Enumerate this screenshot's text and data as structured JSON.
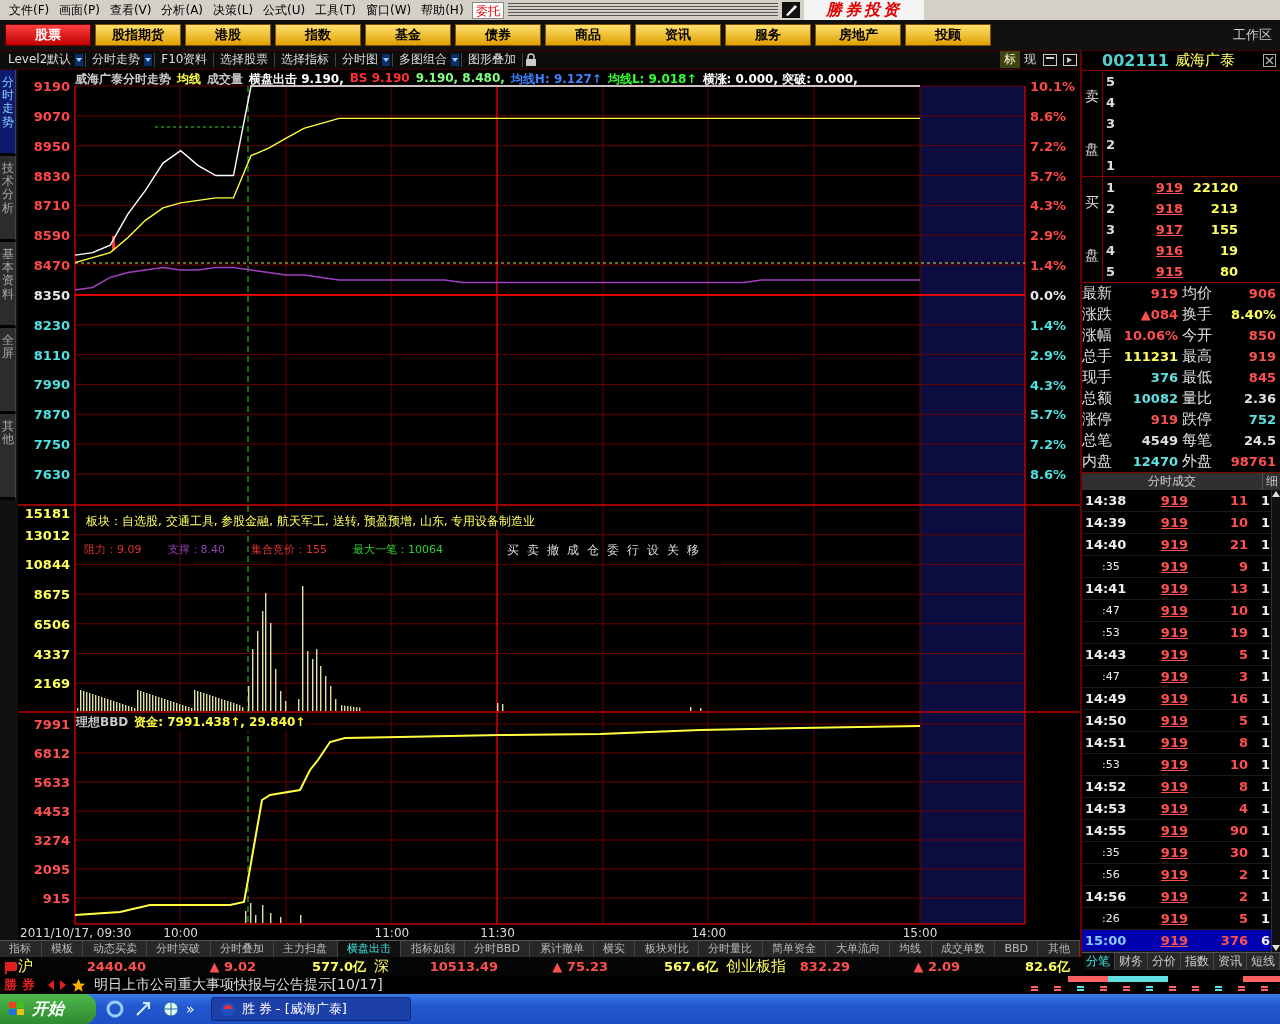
{
  "menu": [
    "文件(F)",
    "画面(P)",
    "查看(V)",
    "分析(A)",
    "决策(L)",
    "公式(U)",
    "工具(T)",
    "窗口(W)",
    "帮助(H)"
  ],
  "order_button": "委托",
  "logo_text": "勝券投资",
  "categories": [
    {
      "label": "股票",
      "selected": true
    },
    {
      "label": "股指期货",
      "selected": false
    },
    {
      "label": "港股",
      "selected": false
    },
    {
      "label": "指数",
      "selected": false
    },
    {
      "label": "基金",
      "selected": false
    },
    {
      "label": "债券",
      "selected": false
    },
    {
      "label": "商品",
      "selected": false
    },
    {
      "label": "资讯",
      "selected": false
    },
    {
      "label": "服务",
      "selected": false
    },
    {
      "label": "房地产",
      "selected": false
    },
    {
      "label": "投顾",
      "selected": false
    }
  ],
  "workspace_label": "工作区",
  "toolbar": [
    {
      "label": "Level2默认",
      "dropdown": true
    },
    {
      "label": "分时走势",
      "dropdown": true
    },
    {
      "label": "F10资料",
      "dropdown": false
    },
    {
      "label": "选择股票",
      "dropdown": false
    },
    {
      "label": "选择指标",
      "dropdown": false
    },
    {
      "label": "分时图",
      "dropdown": true
    },
    {
      "label": "多图组合",
      "dropdown": true
    },
    {
      "label": "图形叠加",
      "dropdown": false
    }
  ],
  "toolbar_right": [
    {
      "label": "标",
      "selected": true
    },
    {
      "label": "现",
      "selected": false
    }
  ],
  "side_tabs": [
    {
      "label": "分时走势",
      "selected": true
    },
    {
      "label": "技术分析",
      "selected": false
    },
    {
      "label": "基本资料",
      "selected": false
    },
    {
      "label": "全屏",
      "selected": false
    },
    {
      "label": "其他",
      "selected": false
    }
  ],
  "chart": {
    "legend": [
      {
        "text": "威海广泰分时走势",
        "color": "#c8c8c8"
      },
      {
        "text": "成交量",
        "color": "#c8c8c8"
      },
      {
        "text": "横盘出击 9.190,",
        "color": "#ffffff"
      },
      {
        "text": "BS 9.190",
        "color": "#ff3030"
      },
      {
        "text": "9.190, 8.480,",
        "color": "#80ff80"
      },
      {
        "text": "均线H: 9.127↑",
        "color": "#4080ff"
      },
      {
        "text": "均线L: 9.018↑",
        "color": "#30ff30"
      },
      {
        "text": "横涨: 0.000, 突破: 0.000,",
        "color": "#ffffff"
      }
    ],
    "chart_data": {
      "type": "line",
      "categories": [
        null,
        null,
        null,
        null,
        null,
        null,
        null,
        null,
        null,
        null,
        null,
        null,
        null,
        null,
        null,
        null,
        null,
        null,
        null,
        null,
        null,
        null,
        null,
        null,
        null,
        null,
        null,
        null,
        null,
        null,
        null,
        null,
        null,
        null,
        null,
        null,
        null,
        null,
        null,
        null,
        null,
        null,
        null,
        null,
        null,
        null,
        null,
        null,
        null
      ],
      "ylim": [
        7630,
        9190
      ],
      "yticks": [
        {
          "value": 9190,
          "label": "9190"
        },
        {
          "value": 9070,
          "label": "9070"
        },
        {
          "value": 8950,
          "label": "8950"
        },
        {
          "value": 8830,
          "label": "8830"
        },
        {
          "value": 8710,
          "label": "8710"
        },
        {
          "value": 8590,
          "label": "8590"
        },
        {
          "value": 8470,
          "label": "8470"
        },
        {
          "value": 8350,
          "label": "8350"
        },
        {
          "value": 8230,
          "label": "8230"
        },
        {
          "value": 8110,
          "label": "8110"
        },
        {
          "value": 7990,
          "label": "7990"
        },
        {
          "value": 7870,
          "label": "7870"
        },
        {
          "value": 7750,
          "label": "7750"
        },
        {
          "value": 7630,
          "label": "7630"
        }
      ],
      "series": [
        {
          "color": "#ffffff",
          "values": [
            8510,
            8520,
            8550,
            8675,
            8770,
            8880,
            8930,
            8870,
            8830,
            8830,
            9190,
            9190,
            9190,
            9190,
            9190,
            9190,
            9190,
            9190,
            9190,
            9190,
            9190,
            9190,
            9190,
            9190,
            9190,
            9190,
            9190,
            9190,
            9190,
            9190,
            9190,
            9190,
            9190,
            9190,
            9190,
            9190,
            9190,
            9190,
            9190,
            9190,
            9190,
            9190,
            9190,
            9190,
            9190,
            9190,
            9190,
            9190,
            9190
          ]
        },
        {
          "name": "均线",
          "color": "#ffff40",
          "values": [
            8480,
            8500,
            8520,
            8580,
            8650,
            8700,
            8720,
            8730,
            8740,
            8740,
            8910,
            8940,
            8980,
            9020,
            9040,
            9060,
            9060,
            9060,
            9060,
            9060,
            9060,
            9060,
            9060,
            9060,
            9060,
            9060,
            9060,
            9060,
            9060,
            9060,
            9060,
            9060,
            9060,
            9060,
            9060,
            9060,
            9060,
            9060,
            9060,
            9060,
            9060,
            9060,
            9060,
            9060,
            9060,
            9060,
            9060,
            9060,
            9060
          ]
        },
        {
          "color": "#a040c0",
          "values": [
            8370,
            8380,
            8420,
            8440,
            8450,
            8460,
            8450,
            8450,
            8460,
            8460,
            8450,
            8440,
            8430,
            8430,
            8420,
            8410,
            8410,
            8410,
            8410,
            8410,
            8410,
            8410,
            8400,
            8400,
            8400,
            8400,
            8400,
            8400,
            8400,
            8400,
            8400,
            8400,
            8400,
            8400,
            8400,
            8400,
            8400,
            8400,
            8400,
            8410,
            8410,
            8410,
            8410,
            8410,
            8410,
            8410,
            8410,
            8410,
            8410
          ]
        }
      ]
    },
    "percent_axis": [
      {
        "label": "10.1%",
        "kind": "up"
      },
      {
        "label": "8.6%",
        "kind": "up"
      },
      {
        "label": "7.2%",
        "kind": "up"
      },
      {
        "label": "5.7%",
        "kind": "up"
      },
      {
        "label": "4.3%",
        "kind": "up"
      },
      {
        "label": "2.9%",
        "kind": "up"
      },
      {
        "label": "1.4%",
        "kind": "up"
      },
      {
        "label": "0.0%",
        "kind": "flat"
      },
      {
        "label": "1.4%",
        "kind": "down"
      },
      {
        "label": "2.9%",
        "kind": "down"
      },
      {
        "label": "4.3%",
        "kind": "down"
      },
      {
        "label": "5.7%",
        "kind": "down"
      },
      {
        "label": "7.2%",
        "kind": "down"
      },
      {
        "label": "8.6%",
        "kind": "down"
      }
    ],
    "volume_axis": [
      "15181",
      "13012",
      "10844",
      "8675",
      "6506",
      "4337",
      "2169"
    ],
    "sectors": "板块：自选股, 交通工具, 参股金融, 航天军工, 送转, 预盈预增, 山东, 专用设备制造业",
    "indicators": [
      {
        "text": "阻力：9.09",
        "color": "#e03030"
      },
      {
        "text": "支撑：8.40",
        "color": "#9040b0"
      },
      {
        "text": "集合竞价：155",
        "color": "#e03030"
      },
      {
        "text": "最大一笔：10064",
        "color": "#30d030"
      }
    ],
    "actions": [
      "买",
      "卖",
      "撤",
      "成",
      "仓",
      "委",
      "行",
      "设",
      "关",
      "移"
    ],
    "bbd_legend": [
      {
        "text": "理想BBD",
        "color": "#c8c8c8"
      },
      {
        "text": "资金: 7991.438↑, 29.840↑",
        "color": "#ffff40"
      }
    ],
    "bbd_axis": [
      "7991",
      "6812",
      "5633",
      "4453",
      "3274",
      "2095",
      "915"
    ],
    "time_axis": [
      "2011/10/17, 09:30",
      "10:00",
      "11:00",
      "11:30",
      "14:00",
      "15:00"
    ]
  },
  "bottom_tabs": [
    {
      "label": "指标",
      "selected": false
    },
    {
      "label": "模板",
      "selected": false
    },
    {
      "label": "动态买卖",
      "selected": false
    },
    {
      "label": "分时突破",
      "selected": false
    },
    {
      "label": "分时叠加",
      "selected": false
    },
    {
      "label": "主力扫盘",
      "selected": false
    },
    {
      "label": "横盘出击",
      "selected": true
    },
    {
      "label": "指标如刻",
      "selected": false
    },
    {
      "label": "分时BBD",
      "selected": false
    },
    {
      "label": "累计撤单",
      "selected": false
    },
    {
      "label": "横实",
      "selected": false
    },
    {
      "label": "板块对比",
      "selected": false
    },
    {
      "label": "分时量比",
      "selected": false
    },
    {
      "label": "简单资金",
      "selected": false
    },
    {
      "label": "大单流向",
      "selected": false
    },
    {
      "label": "均线",
      "selected": false
    },
    {
      "label": "成交单数",
      "selected": false
    },
    {
      "label": "BBD",
      "selected": false
    },
    {
      "label": "其他",
      "selected": false
    }
  ],
  "quote": {
    "code": "002111",
    "name": "威海广泰",
    "sell_side": {
      "label": [
        "卖",
        "盘"
      ],
      "levels": [
        "5",
        "4",
        "3",
        "2",
        "1"
      ]
    },
    "buy_side": {
      "label": [
        "买",
        "盘"
      ],
      "levels": [
        {
          "level": "1",
          "price": "919",
          "volume": "22120"
        },
        {
          "level": "2",
          "price": "918",
          "volume": "213"
        },
        {
          "level": "3",
          "price": "917",
          "volume": "155"
        },
        {
          "level": "4",
          "price": "916",
          "volume": "19"
        },
        {
          "level": "5",
          "price": "915",
          "volume": "80"
        }
      ]
    },
    "stats": [
      {
        "label": "最新",
        "value": "919",
        "color": "#ff5050"
      },
      {
        "label": "均价",
        "value": "906",
        "color": "#ff5050"
      },
      {
        "label": "涨跌",
        "value": "▲084",
        "color": "#ff5050"
      },
      {
        "label": "换手",
        "value": "8.40%",
        "color": "#ffff60"
      },
      {
        "label": "涨幅",
        "value": "10.06%",
        "color": "#ff5050"
      },
      {
        "label": "今开",
        "value": "850",
        "color": "#ff5050"
      },
      {
        "label": "总手",
        "value": "111231",
        "color": "#ffff60"
      },
      {
        "label": "最高",
        "value": "919",
        "color": "#ff5050"
      },
      {
        "label": "现手",
        "value": "376",
        "color": "#60e0e0"
      },
      {
        "label": "最低",
        "value": "845",
        "color": "#ff5050"
      },
      {
        "label": "总额",
        "value": "10082",
        "color": "#60e0e0"
      },
      {
        "label": "量比",
        "value": "2.36",
        "color": "#e0e0e0"
      },
      {
        "label": "涨停",
        "value": "919",
        "color": "#ff5050"
      },
      {
        "label": "跌停",
        "value": "752",
        "color": "#60e0e0"
      },
      {
        "label": "总笔",
        "value": "4549",
        "color": "#e0e0e0"
      },
      {
        "label": "每笔",
        "value": "24.5",
        "color": "#e0e0e0"
      },
      {
        "label": "内盘",
        "value": "12470",
        "color": "#60e0e0"
      },
      {
        "label": "外盘",
        "value": "98761",
        "color": "#ff5050"
      }
    ]
  },
  "ticks": {
    "title": "分时成交",
    "detail": "细",
    "rows": [
      {
        "time": "14:38",
        "kind": "minute",
        "price": "919",
        "volume": "11",
        "count": "1",
        "selected": false
      },
      {
        "time": "14:39",
        "kind": "minute",
        "price": "919",
        "volume": "10",
        "count": "1",
        "selected": false
      },
      {
        "time": "14:40",
        "kind": "minute",
        "price": "919",
        "volume": "21",
        "count": "1",
        "selected": false
      },
      {
        "time": ":35",
        "kind": "second",
        "price": "919",
        "volume": "9",
        "count": "1",
        "selected": false
      },
      {
        "time": "14:41",
        "kind": "minute",
        "price": "919",
        "volume": "13",
        "count": "1",
        "selected": false
      },
      {
        "time": ":47",
        "kind": "second",
        "price": "919",
        "volume": "10",
        "count": "1",
        "selected": false
      },
      {
        "time": ":53",
        "kind": "second",
        "price": "919",
        "volume": "19",
        "count": "1",
        "selected": false
      },
      {
        "time": "14:43",
        "kind": "minute",
        "price": "919",
        "volume": "5",
        "count": "1",
        "selected": false
      },
      {
        "time": ":47",
        "kind": "second",
        "price": "919",
        "volume": "3",
        "count": "1",
        "selected": false
      },
      {
        "time": "14:49",
        "kind": "minute",
        "price": "919",
        "volume": "16",
        "count": "1",
        "selected": false
      },
      {
        "time": "14:50",
        "kind": "minute",
        "price": "919",
        "volume": "5",
        "count": "1",
        "selected": false
      },
      {
        "time": "14:51",
        "kind": "minute",
        "price": "919",
        "volume": "8",
        "count": "1",
        "selected": false
      },
      {
        "time": ":53",
        "kind": "second",
        "price": "919",
        "volume": "10",
        "count": "1",
        "selected": false
      },
      {
        "time": "14:52",
        "kind": "minute",
        "price": "919",
        "volume": "8",
        "count": "1",
        "selected": false
      },
      {
        "time": "14:53",
        "kind": "minute",
        "price": "919",
        "volume": "4",
        "count": "1",
        "selected": false
      },
      {
        "time": "14:55",
        "kind": "minute",
        "price": "919",
        "volume": "90",
        "count": "1",
        "selected": false
      },
      {
        "time": ":35",
        "kind": "second",
        "price": "919",
        "volume": "30",
        "count": "1",
        "selected": false
      },
      {
        "time": ":56",
        "kind": "second",
        "price": "919",
        "volume": "2",
        "count": "1",
        "selected": false
      },
      {
        "time": "14:56",
        "kind": "minute",
        "price": "919",
        "volume": "2",
        "count": "1",
        "selected": false
      },
      {
        "time": ":26",
        "kind": "second",
        "price": "919",
        "volume": "5",
        "count": "1",
        "selected": false
      },
      {
        "time": "15:00",
        "kind": "minute",
        "price": "919",
        "volume": "376",
        "count": "6",
        "selected": true
      }
    ]
  },
  "right_tabs": [
    {
      "label": "分笔",
      "selected": true
    },
    {
      "label": "财务",
      "selected": false
    },
    {
      "label": "分价",
      "selected": false
    },
    {
      "label": "指数",
      "selected": false
    },
    {
      "label": "资讯",
      "selected": false
    },
    {
      "label": "短线",
      "selected": false
    }
  ],
  "indices": [
    {
      "name": "沪",
      "price": "2440.40",
      "change": "▲ 9.02",
      "amount": "577.0亿"
    },
    {
      "name": "深",
      "price": "10513.49",
      "change": "▲ 75.23",
      "amount": "567.6亿"
    },
    {
      "name": "创业板指",
      "price": "832.29",
      "change": "▲ 2.09",
      "amount": "82.6亿"
    }
  ],
  "news": {
    "brand": "勝 券",
    "headline": "明日上市公司重大事项快报与公告提示[10/17]"
  },
  "taskbar": {
    "start": "开始",
    "more": "»",
    "task": "胜 券 - [威海广泰]"
  }
}
